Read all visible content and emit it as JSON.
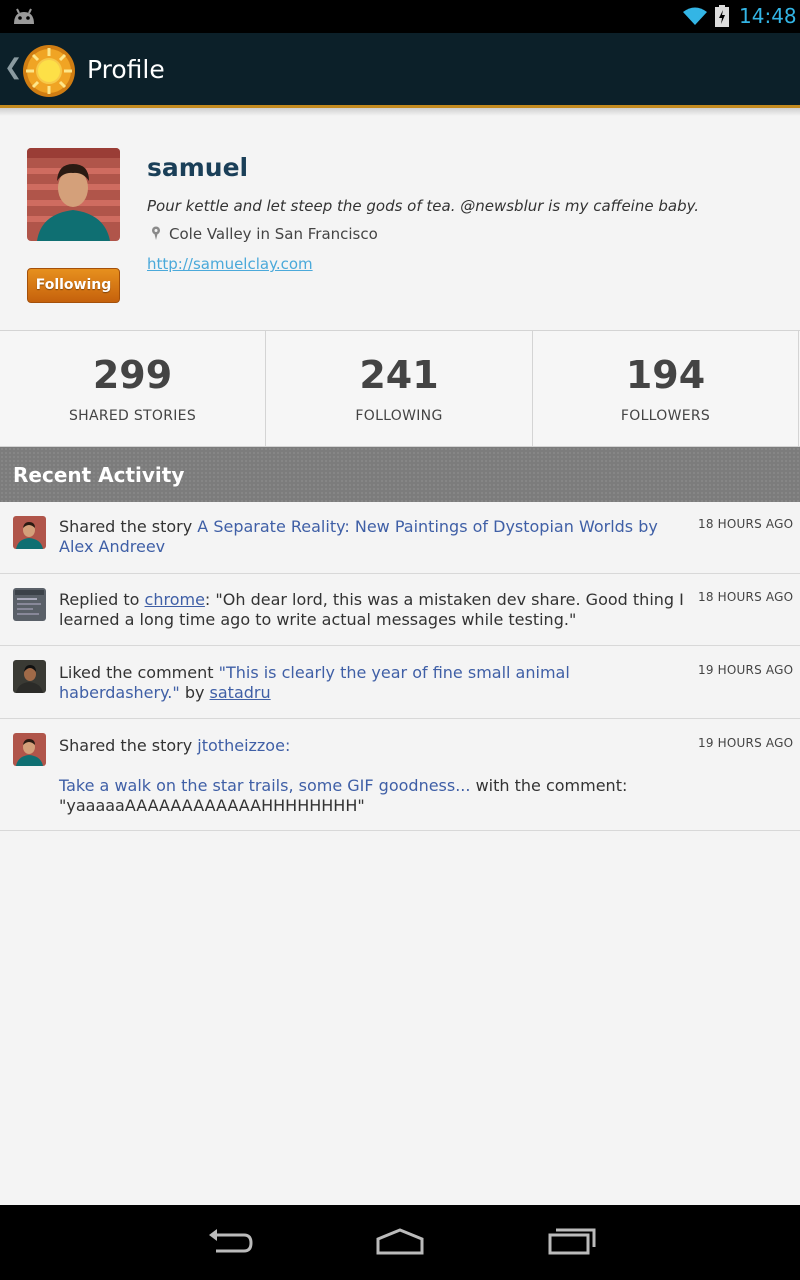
{
  "status_bar": {
    "time": "14:48"
  },
  "action_bar": {
    "title": "Profile"
  },
  "profile": {
    "username": "samuel",
    "bio": "Pour kettle and let steep the gods of tea. @newsblur is my caffeine baby.",
    "location": "Cole Valley in San Francisco",
    "website": "http://samuelclay.com",
    "follow_button_label": "Following"
  },
  "stats": [
    {
      "value": "299",
      "label": "SHARED STORIES"
    },
    {
      "value": "241",
      "label": "FOLLOWING"
    },
    {
      "value": "194",
      "label": "FOLLOWERS"
    }
  ],
  "recent_activity": {
    "header": "Recent Activity",
    "items": [
      {
        "prefix": "Shared the story ",
        "link": "A Separate Reality: New Paintings of Dystopian Worlds by Alex Andreev",
        "time": "18 HOURS AGO"
      },
      {
        "prefix": "Replied to ",
        "user": "chrome",
        "suffix": ": \"Oh dear lord, this was a mistaken dev share. Good thing I learned a long time ago to write actual messages while testing.\"",
        "time": "18 HOURS AGO"
      },
      {
        "prefix": "Liked the comment ",
        "link": "\"This is clearly the year of fine small animal haberdashery.\"",
        "mid": " by ",
        "user": "satadru",
        "time": "19 HOURS AGO"
      },
      {
        "prefix": "Shared the story ",
        "user": "jtotheizzoe:",
        "link": "Take a walk on the star trails, some GIF goodness...",
        "suffix": " with the comment: \"yaaaaaAAAAAAAAAAAAHHHHHHHH\"",
        "time": "19 HOURS AGO"
      }
    ]
  }
}
